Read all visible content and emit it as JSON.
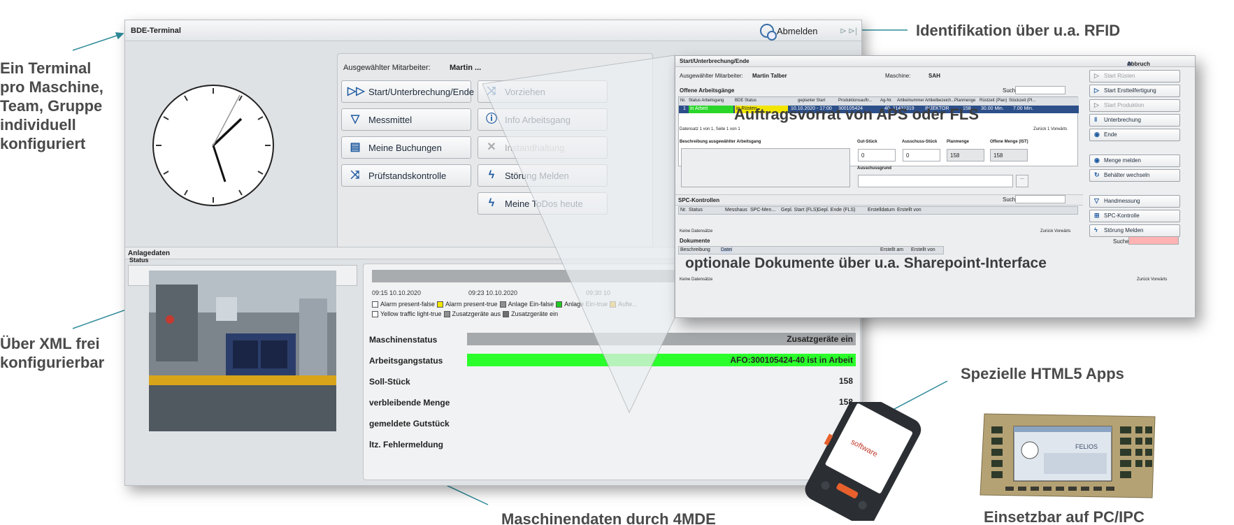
{
  "annotations": {
    "left_terminal": [
      "Ein Terminal",
      "pro Maschine,",
      "Team, Gruppe",
      "individuell",
      "konfiguriert"
    ],
    "left_xml": [
      "Über XML frei",
      "konfigurierbar"
    ],
    "top_rfid": "Identifikation über u.a. RFID",
    "aps": "Auftragsvorrat von APS oder FLS",
    "docs": "optionale Dokumente über u.a. Sharepoint-Interface",
    "html5": "Spezielle HTML5 Apps",
    "pcipc": "Einsetzbar auf PC/IPC",
    "mde": "Maschinendaten durch 4MDE"
  },
  "bde": {
    "title": "BDE-Terminal",
    "logout_label": "Abmelden",
    "employee_label": "Ausgewählter Mitarbeiter:",
    "employee_value": "Martin ...",
    "buttons": {
      "start": "Start/Unterbrechung/Ende",
      "vorziehen": "Vorziehen",
      "messmittel": "Messmittel",
      "info": "Info Arbeitsgang",
      "buchungen": "Meine Buchungen",
      "instand": "Instandhaltung",
      "pruef": "Prüfstandskontrolle",
      "stoerung": "Störung Melden",
      "todos": "Meine ToDos heute"
    },
    "anlagedaten": "Anlagedaten",
    "status_label": "Status",
    "status_value": "-",
    "timeline": {
      "ticks": [
        "09:15 10.10.2020",
        "09:23 10.10.2020",
        "09:30 10"
      ],
      "legend_row1": [
        "Alarm present-false",
        "Alarm present-true",
        "Anlage Ein-false",
        "Anlage Ein-true",
        "Aufw..."
      ],
      "legend_row2": [
        "Yellow traffic light-true",
        "Zusatzgeräte aus",
        "Zusatzgeräte ein"
      ],
      "legend_colors": [
        "#ffffff",
        "#f2e600",
        "#909090",
        "#22c922",
        "#e8b400",
        "#ffffff",
        "#909090",
        "#707070"
      ]
    },
    "rows": [
      {
        "label": "Maschinenstatus",
        "value": "Zusatzgeräte ein",
        "bg": "#a6a9ac"
      },
      {
        "label": "Arbeitsgangstatus",
        "value": "AFO:300105424-40 ist in Arbeit",
        "bg": "#2bff2b"
      },
      {
        "label": "Soll-Stück",
        "value": "158",
        "bg": ""
      },
      {
        "label": "verbleibende Menge",
        "value": "158",
        "bg": ""
      },
      {
        "label": "gemeldete Gutstück",
        "value": "",
        "bg": ""
      },
      {
        "label": "ltz. Fehlermeldung",
        "value": "",
        "bg": ""
      }
    ]
  },
  "overlay": {
    "title": "Start/Unterbrechung/Ende",
    "abbruch": "Abbruch",
    "employee_label": "Ausgewählter Mitarbeiter:",
    "employee_value": "Martin Talber",
    "machine_label": "Maschine:",
    "machine_value": "SAH",
    "open_ops": "Offene Arbeitsgänge",
    "search": "Suche",
    "table_headers": [
      "Nr.",
      "Status Arbeitsgang",
      "BDE Status",
      "geplanter Start",
      "Produktionsauftr...",
      "Ag-Nr.",
      "Artikelnummer",
      "Artikelbezeich...",
      "Planmenge",
      "Rüstzeit (Plan)",
      "Stückzeit (Pl..."
    ],
    "table_row": [
      "1",
      "in Arbeit",
      "in Rüsten",
      "10.10.2020 - 17:00",
      "300105424",
      "40",
      "11432319",
      "INJEKTOR",
      "158",
      "30.00 Min.",
      "7.00 Min."
    ],
    "record_info": "Datensatz 1 von 1, Seite 1 von 1",
    "nav_info": "Zurück 1 Vorwärts",
    "desc_label": "Beschreibung ausgewählter Arbeitsgang",
    "gut": "Gut-Stück",
    "gut_val": "0",
    "aus": "Ausschuss-Stück",
    "aus_val": "0",
    "plan": "Planmenge",
    "plan_val": "158",
    "offen": "Offene Menge (IST)",
    "offen_val": "158",
    "grund": "Ausschussgrund",
    "spc": "SPC-Kontrollen",
    "spc_headers": [
      "Nr.",
      "Status",
      "Messhaus",
      "SPC-Men...",
      "Gepl. Start (FLS)",
      "Gepl. Ende (FLS)",
      "Erstelldatum",
      "Erstellt von"
    ],
    "keine": "Keine Datensätze",
    "zurueck": "Zurück Vorwärts",
    "dokumente": "Dokumente",
    "doc_headers": [
      "Beschreibung",
      "Datei",
      "Erstellt am",
      "Erstellt von"
    ],
    "side_buttons": [
      {
        "label": "Start Rüsten",
        "icon": "▷",
        "dis": true
      },
      {
        "label": "Start Erstteilfertigung",
        "icon": "▷",
        "dis": false
      },
      {
        "label": "Start Produktion",
        "icon": "▷",
        "dis": true
      },
      {
        "label": "Unterbrechung",
        "icon": "‖",
        "dis": false
      },
      {
        "label": "Ende",
        "icon": "◉",
        "dis": false
      },
      {
        "label": "Menge melden",
        "icon": "◉",
        "dis": false
      },
      {
        "label": "Behälter wechseln",
        "icon": "↻",
        "dis": false
      },
      {
        "label": "Handmessung",
        "icon": "▽",
        "dis": false
      },
      {
        "label": "SPC-Kontrolle",
        "icon": "⊞",
        "dis": false
      },
      {
        "label": "Störung Melden",
        "icon": "ϟ",
        "dis": false
      }
    ]
  },
  "device_logo": "software",
  "pc_logo": "FELIOS"
}
